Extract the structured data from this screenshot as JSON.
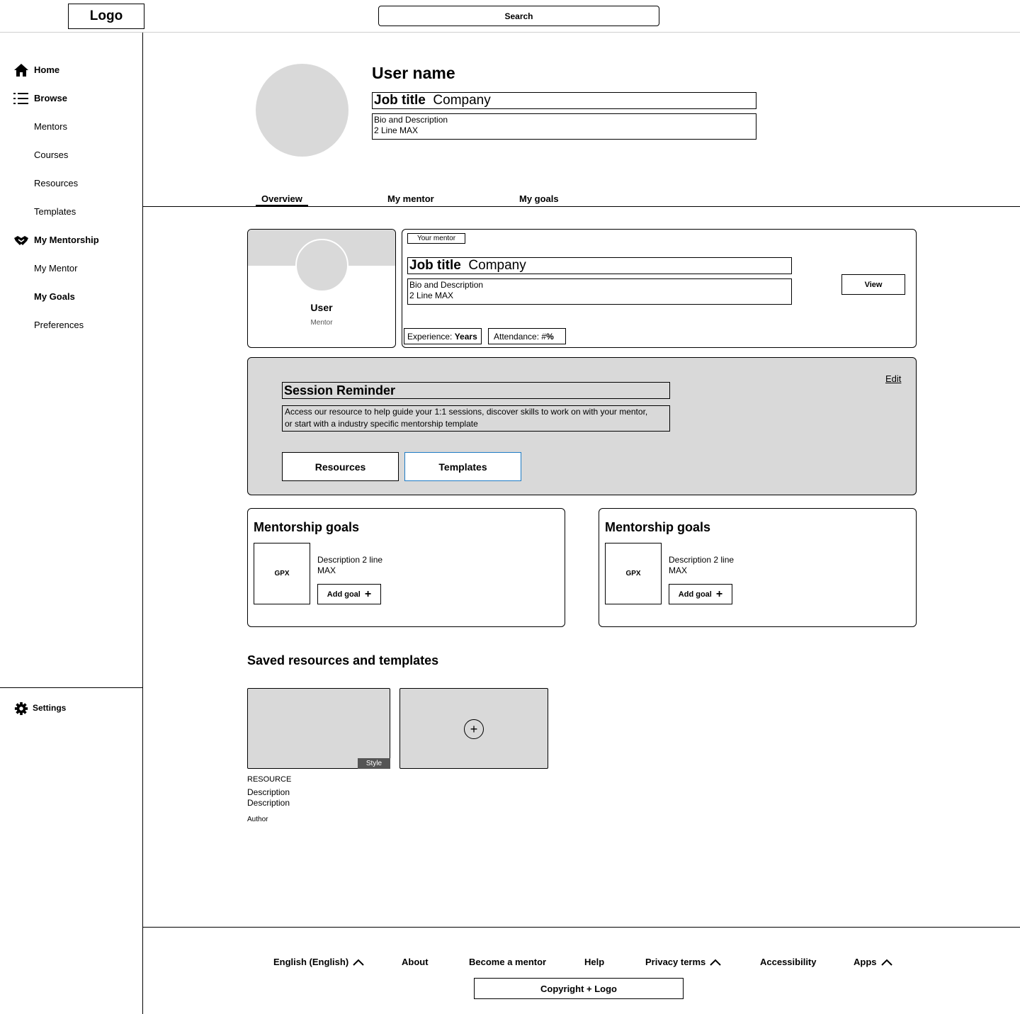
{
  "header": {
    "logo": "Logo",
    "search_label": "Search"
  },
  "sidebar": {
    "items": [
      {
        "label": "Home",
        "icon": "home-icon"
      },
      {
        "label": "Browse",
        "icon": "list-icon"
      },
      {
        "label": "Mentors"
      },
      {
        "label": "Courses"
      },
      {
        "label": "Resources"
      },
      {
        "label": "Templates"
      },
      {
        "label": "My Mentorship",
        "icon": "handshake-icon"
      },
      {
        "label": "My Mentor"
      },
      {
        "label": "My Goals"
      },
      {
        "label": "Preferences"
      }
    ],
    "settings": {
      "label": "Settings",
      "icon": "gear-icon"
    }
  },
  "profile": {
    "user_name": "User name",
    "job_title": "Job title",
    "company": "Company",
    "bio_line1": "Bio and Description",
    "bio_line2": "2 Line MAX"
  },
  "tabs": [
    {
      "label": "Overview",
      "active": true
    },
    {
      "label": "My mentor"
    },
    {
      "label": "My goals"
    }
  ],
  "mentor_card": {
    "user": "User",
    "role": "Mentor",
    "tag": "Your mentor",
    "job_title": "Job title",
    "company": "Company",
    "bio_line1": "Bio and Description",
    "bio_line2": "2 Line MAX",
    "view_label": "View",
    "experience_label": "Experience:",
    "experience_value": "Years",
    "attendance_label": "Attendance: #",
    "attendance_value": "%"
  },
  "session": {
    "title": "Session Reminder",
    "desc_line1": "Access our resource to help guide your 1:1 sessions, discover skills to work on with your mentor,",
    "desc_line2": "or start with a industry specific mentorship template",
    "edit_label": "Edit",
    "resources_label": "Resources",
    "templates_label": "Templates"
  },
  "goals": [
    {
      "title": "Mentorship goals",
      "gpx": "GPX",
      "desc_line1": "Description 2 line",
      "desc_line2": "MAX",
      "button": "Add goal"
    },
    {
      "title": "Mentorship goals",
      "gpx": "GPX",
      "desc_line1": "Description 2 line",
      "desc_line2": "MAX",
      "button": "Add goal"
    }
  ],
  "saved": {
    "title": "Saved resources and templates",
    "style_tag": "Style",
    "add_symbol": "+",
    "kind": "RESOURCE",
    "desc1": "Description",
    "desc2": "Description",
    "author": "Author"
  },
  "footer": {
    "links": [
      "English (English)",
      "About",
      "Become a mentor",
      "Help",
      "Privacy terms",
      "Accessibility",
      "Apps"
    ],
    "copyright": "Copyright + Logo"
  },
  "colors": {
    "placeholder_gray": "#d9d9d9",
    "focus_blue": "#1e7bc4",
    "tag_dark": "#555555"
  }
}
